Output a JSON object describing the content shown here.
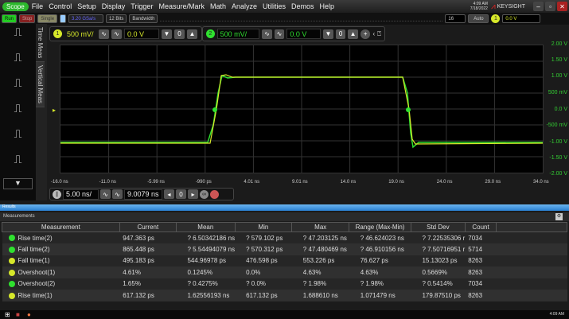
{
  "menubar": {
    "scope": "Scope",
    "items": [
      "File",
      "Control",
      "Setup",
      "Display",
      "Trigger",
      "Measure/Mark",
      "Math",
      "Analyze",
      "Utilities",
      "Demos",
      "Help"
    ],
    "time": "4:09 AM",
    "date": "7/18/2022",
    "brand": "KEYSIGHT"
  },
  "toolbar": {
    "run": "Run",
    "stop": "Stop",
    "single": "Single",
    "sample_rate": "3.20 GSa/s",
    "bits": "12 Bits",
    "bandwidth": "Bandwidth",
    "avg": "16",
    "auto": "Auto",
    "trig_level": "0.0 V"
  },
  "ch1": {
    "num": "1",
    "scale": "500 mV/",
    "offset": "0.0 V",
    "color": "#d6e82a"
  },
  "ch2": {
    "num": "2",
    "scale": "500 mV/",
    "offset": "0.0 V",
    "color": "#2fe02f"
  },
  "tabs": [
    "Time Meas",
    "Vertical Meas"
  ],
  "y_labels": [
    "2.00 V",
    "1.50 V",
    "1.00 V",
    "500 mV",
    "0.0 V",
    "-500 mV",
    "-1.00 V",
    "-1.50 V",
    "-2.00 V"
  ],
  "x_labels": [
    "-16.0 ns",
    "-11.0 ns",
    "-5.99 ns",
    "-990 ps",
    "4.01 ns",
    "9.01 ns",
    "14.0 ns",
    "19.0 ns",
    "24.0 ns",
    "29.0 ns",
    "34.0 ns"
  ],
  "timebase": {
    "scale": "5.00 ns/",
    "position": "9.0079 ns"
  },
  "results_label": "Results",
  "measurements_label": "Measurements",
  "table": {
    "headers": [
      "Measurement",
      "Current",
      "Mean",
      "Min",
      "Max",
      "Range (Max-Min)",
      "Std Dev",
      "Count",
      ""
    ],
    "rows": [
      {
        "ch": "2",
        "color": "#2fe02f",
        "cells": [
          "Rise time(2)",
          "947.363 ps",
          "? 6.50342186 ns",
          "? 579.102 ps",
          "? 47.203125 ns",
          "? 46.624023 ns",
          "? 7.22535306 r",
          "7034"
        ]
      },
      {
        "ch": "2",
        "color": "#2fe02f",
        "cells": [
          "Fall time(2)",
          "865.448 ps",
          "? 5.54494079 ns",
          "? 570.312 ps",
          "? 47.480469 ns",
          "? 46.910156 ns",
          "? 7.50716951 r",
          "5714"
        ]
      },
      {
        "ch": "1",
        "color": "#d6e82a",
        "cells": [
          "Fall time(1)",
          "495.183 ps",
          "544.96978 ps",
          "476.598 ps",
          "553.226 ps",
          "76.627 ps",
          "15.13023 ps",
          "8263"
        ]
      },
      {
        "ch": "1",
        "color": "#d6e82a",
        "cells": [
          "Overshoot(1)",
          "4.61%",
          "0.1245%",
          "0.0%",
          "4.63%",
          "4.63%",
          "0.5669%",
          "8263"
        ]
      },
      {
        "ch": "2",
        "color": "#2fe02f",
        "cells": [
          "Overshoot(2)",
          "1.65%",
          "? 0.4275%",
          "? 0.0%",
          "? 1.98%",
          "? 1.98%",
          "? 0.5414%",
          "7034"
        ]
      },
      {
        "ch": "1",
        "color": "#d6e82a",
        "cells": [
          "Rise time(1)",
          "617.132 ps",
          "1.62556193 ns",
          "617.132 ps",
          "1.688610 ns",
          "1.071479 ns",
          "179.87510 ps",
          "8263"
        ]
      }
    ]
  },
  "taskbar": {
    "time": "4:09 AM"
  }
}
